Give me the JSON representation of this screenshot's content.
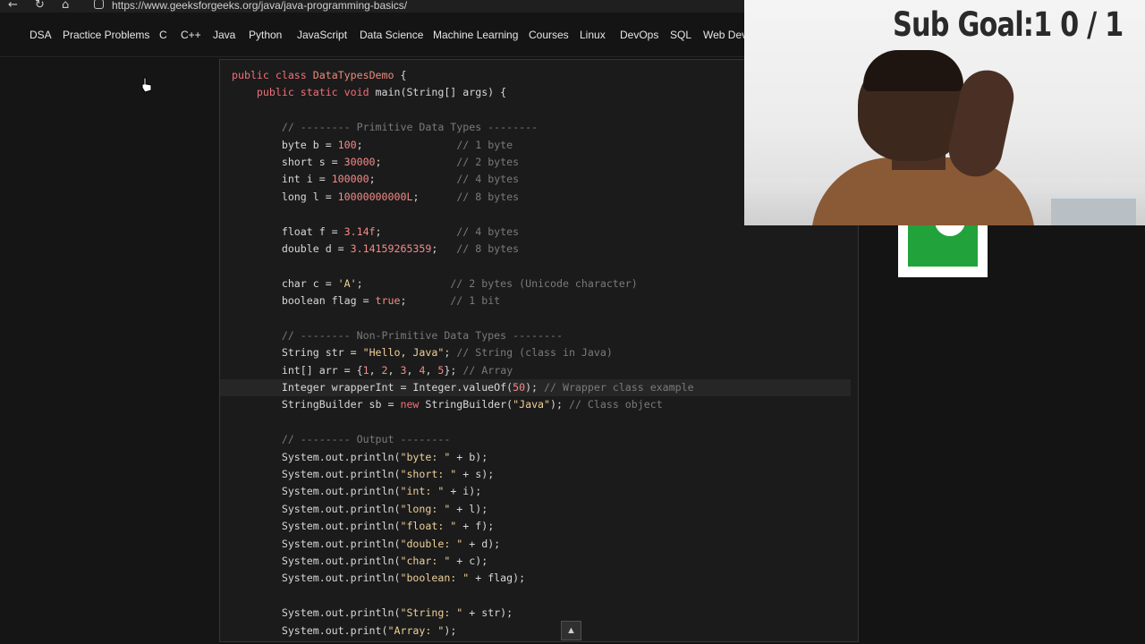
{
  "browser": {
    "url": "https://www.geeksforgeeks.org/java/java-programming-basics/",
    "icons": [
      "back-icon",
      "reload-icon",
      "home-icon",
      "site-info-icon"
    ]
  },
  "menu": {
    "items": [
      "DSA",
      "Practice Problems",
      "C",
      "C++",
      "Java",
      "Python",
      "JavaScript",
      "Data Science",
      "Machine Learning",
      "Courses",
      "Linux",
      "DevOps",
      "SQL",
      "Web Deve"
    ]
  },
  "code": {
    "lines": [
      [
        {
          "t": "public class ",
          "c": "kw"
        },
        {
          "t": "DataTypesDemo",
          "c": "cls"
        },
        {
          "t": " {",
          "c": ""
        }
      ],
      [
        {
          "t": "    ",
          "c": ""
        },
        {
          "t": "public static void ",
          "c": "kw"
        },
        {
          "t": "main(String[] args) {",
          "c": ""
        }
      ],
      [
        {
          "t": "",
          "c": ""
        }
      ],
      [
        {
          "t": "        ",
          "c": ""
        },
        {
          "t": "// -------- Primitive Data Types --------",
          "c": "cmt"
        }
      ],
      [
        {
          "t": "        byte b = ",
          "c": ""
        },
        {
          "t": "100",
          "c": "num"
        },
        {
          "t": ";               ",
          "c": ""
        },
        {
          "t": "// 1 byte",
          "c": "cmt"
        }
      ],
      [
        {
          "t": "        short s = ",
          "c": ""
        },
        {
          "t": "30000",
          "c": "num"
        },
        {
          "t": ";            ",
          "c": ""
        },
        {
          "t": "// 2 bytes",
          "c": "cmt"
        }
      ],
      [
        {
          "t": "        int i = ",
          "c": ""
        },
        {
          "t": "100000",
          "c": "num"
        },
        {
          "t": ";             ",
          "c": ""
        },
        {
          "t": "// 4 bytes",
          "c": "cmt"
        }
      ],
      [
        {
          "t": "        long l = ",
          "c": ""
        },
        {
          "t": "10000000000L",
          "c": "num"
        },
        {
          "t": ";      ",
          "c": ""
        },
        {
          "t": "// 8 bytes",
          "c": "cmt"
        }
      ],
      [
        {
          "t": "",
          "c": ""
        }
      ],
      [
        {
          "t": "        float f = ",
          "c": ""
        },
        {
          "t": "3.14f",
          "c": "num"
        },
        {
          "t": ";            ",
          "c": ""
        },
        {
          "t": "// 4 bytes",
          "c": "cmt"
        }
      ],
      [
        {
          "t": "        double d = ",
          "c": ""
        },
        {
          "t": "3.14159265359",
          "c": "num"
        },
        {
          "t": ";   ",
          "c": ""
        },
        {
          "t": "// 8 bytes",
          "c": "cmt"
        }
      ],
      [
        {
          "t": "",
          "c": ""
        }
      ],
      [
        {
          "t": "        char c = ",
          "c": ""
        },
        {
          "t": "'A'",
          "c": "str"
        },
        {
          "t": ";              ",
          "c": ""
        },
        {
          "t": "// 2 bytes (Unicode character)",
          "c": "cmt"
        }
      ],
      [
        {
          "t": "        boolean flag = ",
          "c": ""
        },
        {
          "t": "true",
          "c": "num"
        },
        {
          "t": ";       ",
          "c": ""
        },
        {
          "t": "// 1 bit",
          "c": "cmt"
        }
      ],
      [
        {
          "t": "",
          "c": ""
        }
      ],
      [
        {
          "t": "        ",
          "c": ""
        },
        {
          "t": "// -------- Non-Primitive Data Types --------",
          "c": "cmt"
        }
      ],
      [
        {
          "t": "        String str = ",
          "c": ""
        },
        {
          "t": "\"Hello, Java\"",
          "c": "str"
        },
        {
          "t": "; ",
          "c": ""
        },
        {
          "t": "// String (class in Java)",
          "c": "cmt"
        }
      ],
      [
        {
          "t": "        int[] arr = {",
          "c": ""
        },
        {
          "t": "1",
          "c": "num"
        },
        {
          "t": ", ",
          "c": ""
        },
        {
          "t": "2",
          "c": "num"
        },
        {
          "t": ", ",
          "c": ""
        },
        {
          "t": "3",
          "c": "num"
        },
        {
          "t": ", ",
          "c": ""
        },
        {
          "t": "4",
          "c": "num"
        },
        {
          "t": ", ",
          "c": ""
        },
        {
          "t": "5",
          "c": "num"
        },
        {
          "t": "}; ",
          "c": ""
        },
        {
          "t": "// Array",
          "c": "cmt"
        }
      ],
      [
        {
          "t": "        Integer wrapperInt = Integer.valueOf(",
          "c": ""
        },
        {
          "t": "50",
          "c": "num"
        },
        {
          "t": "); ",
          "c": ""
        },
        {
          "t": "// Wrapper class example",
          "c": "cmt"
        }
      ],
      [
        {
          "t": "        StringBuilder sb = ",
          "c": ""
        },
        {
          "t": "new ",
          "c": "kw"
        },
        {
          "t": "StringBuilder(",
          "c": ""
        },
        {
          "t": "\"Java\"",
          "c": "str"
        },
        {
          "t": "); ",
          "c": ""
        },
        {
          "t": "// Class object",
          "c": "cmt"
        }
      ],
      [
        {
          "t": "",
          "c": ""
        }
      ],
      [
        {
          "t": "        ",
          "c": ""
        },
        {
          "t": "// -------- Output --------",
          "c": "cmt"
        }
      ],
      [
        {
          "t": "        System.out.println(",
          "c": ""
        },
        {
          "t": "\"byte: \"",
          "c": "str"
        },
        {
          "t": " + b);",
          "c": ""
        }
      ],
      [
        {
          "t": "        System.out.println(",
          "c": ""
        },
        {
          "t": "\"short: \"",
          "c": "str"
        },
        {
          "t": " + s);",
          "c": ""
        }
      ],
      [
        {
          "t": "        System.out.println(",
          "c": ""
        },
        {
          "t": "\"int: \"",
          "c": "str"
        },
        {
          "t": " + i);",
          "c": ""
        }
      ],
      [
        {
          "t": "        System.out.println(",
          "c": ""
        },
        {
          "t": "\"long: \"",
          "c": "str"
        },
        {
          "t": " + l);",
          "c": ""
        }
      ],
      [
        {
          "t": "        System.out.println(",
          "c": ""
        },
        {
          "t": "\"float: \"",
          "c": "str"
        },
        {
          "t": " + f);",
          "c": ""
        }
      ],
      [
        {
          "t": "        System.out.println(",
          "c": ""
        },
        {
          "t": "\"double: \"",
          "c": "str"
        },
        {
          "t": " + d);",
          "c": ""
        }
      ],
      [
        {
          "t": "        System.out.println(",
          "c": ""
        },
        {
          "t": "\"char: \"",
          "c": "str"
        },
        {
          "t": " + c);",
          "c": ""
        }
      ],
      [
        {
          "t": "        System.out.println(",
          "c": ""
        },
        {
          "t": "\"boolean: \"",
          "c": "str"
        },
        {
          "t": " + flag);",
          "c": ""
        }
      ],
      [
        {
          "t": "",
          "c": ""
        }
      ],
      [
        {
          "t": "        System.out.println(",
          "c": ""
        },
        {
          "t": "\"String: \"",
          "c": "str"
        },
        {
          "t": " + str);",
          "c": ""
        }
      ],
      [
        {
          "t": "        System.out.print(",
          "c": ""
        },
        {
          "t": "\"Array: \"",
          "c": "str"
        },
        {
          "t": ");",
          "c": ""
        }
      ]
    ],
    "highlighted_line": 18
  },
  "overlay": {
    "goal_text": "Sub Goal:1  0 / 1"
  },
  "scroll_up_label": "▲",
  "colors": {
    "background": "#121212",
    "code_bg": "#1b1b1b",
    "keyword": "#f26f79",
    "string": "#efcf98",
    "comment": "#7a7a7a"
  }
}
